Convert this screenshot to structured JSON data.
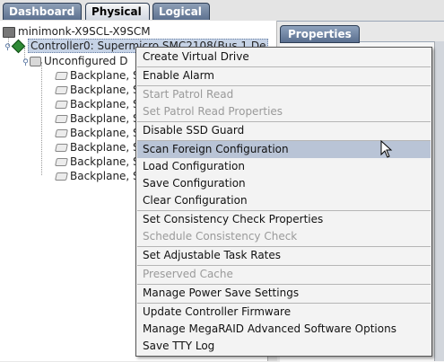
{
  "tabs": [
    {
      "label": "Dashboard",
      "active": false
    },
    {
      "label": "Physical",
      "active": true
    },
    {
      "label": "Logical",
      "active": false
    }
  ],
  "tree": {
    "server": "minimonk-X9SCL-X9SCM",
    "controller": "Controller0: Supermicro SMC2108(Bus 1,De",
    "group": "Unconfigured D",
    "backplanes": [
      "Backplane, S",
      "Backplane, S",
      "Backplane, S",
      "Backplane, S",
      "Backplane, S",
      "Backplane, S",
      "Backplane, S",
      "Backplane, S"
    ]
  },
  "properties_tab": "Properties",
  "menu": {
    "items": [
      {
        "label": "Create Virtual Drive",
        "disabled": false
      },
      {
        "label": "Enable Alarm",
        "disabled": false
      },
      {
        "label": "Start Patrol Read",
        "disabled": true
      },
      {
        "label": "Set Patrol Read Properties",
        "disabled": true
      },
      {
        "label": "Disable SSD Guard",
        "disabled": false
      },
      {
        "label": "Scan Foreign Configuration",
        "disabled": false,
        "highlighted": true
      },
      {
        "label": "Load Configuration",
        "disabled": false
      },
      {
        "label": "Save Configuration",
        "disabled": false
      },
      {
        "label": "Clear Configuration",
        "disabled": false
      },
      {
        "label": "Set Consistency Check Properties",
        "disabled": false
      },
      {
        "label": "Schedule Consistency Check",
        "disabled": true
      },
      {
        "label": "Set Adjustable Task Rates",
        "disabled": false
      },
      {
        "label": "Preserved Cache",
        "disabled": true
      },
      {
        "label": "Manage Power Save Settings",
        "disabled": false
      },
      {
        "label": "Update Controller Firmware",
        "disabled": false
      },
      {
        "label": "Manage MegaRAID Advanced Software Options",
        "disabled": false
      },
      {
        "label": "Save TTY Log",
        "disabled": false
      }
    ]
  },
  "colors": {
    "tab_active_bg": "#e8ebf0",
    "tab_inactive_bg": "#6f82a0",
    "menu_highlight": "#b9c4d6",
    "disabled_text": "#9a9a9a"
  }
}
